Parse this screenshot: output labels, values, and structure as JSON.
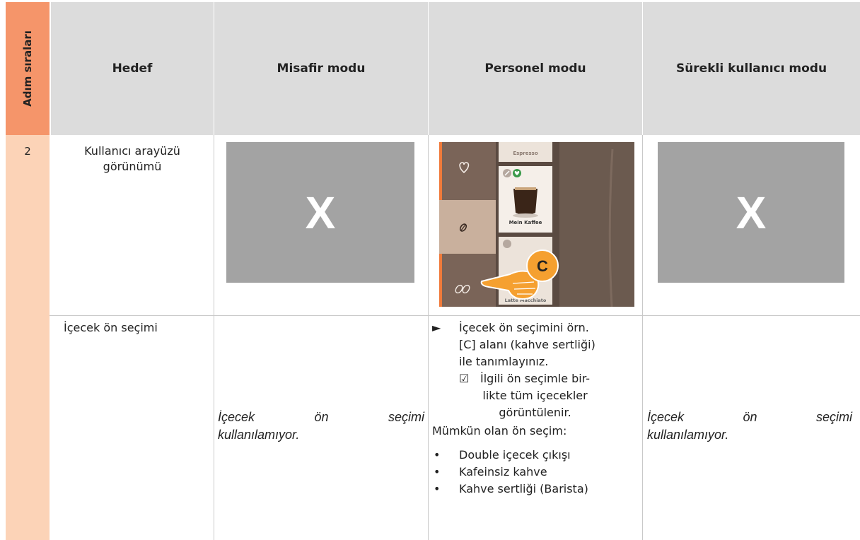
{
  "header": {
    "step_column": "Adım sıraları",
    "target": "Hedef",
    "guest": "Misafir modu",
    "staff": "Personel modu",
    "continuous": "Sürekli kullanıcı modu"
  },
  "rows": [
    {
      "step": "2",
      "target_line1": "Kullanıcı arayüzü",
      "target_line2": "görünümü",
      "guest_mark": "X",
      "continuous_mark": "X",
      "staff_screenshot": {
        "top_label": "Espresso",
        "card_label": "Mein Kaffee",
        "bottom_label": "Latte Macchiato",
        "callout": "C"
      }
    },
    {
      "target": "İçecek ön seçimi",
      "guest_line1_words": [
        "İçecek",
        "ön",
        "seçimi"
      ],
      "guest_line2": "kullanılamıyor.",
      "continuous_line1_words": [
        "İçecek",
        "ön",
        "seçimi"
      ],
      "continuous_line2": "kullanılamıyor.",
      "staff": {
        "step_marker": "►",
        "step_lines": [
          "İçecek ön seçimini örn.",
          "[C] alanı (kahve sertliği)",
          "ile tanımlayınız."
        ],
        "result_marker": "☑",
        "result_lines": [
          "İlgili ön seçimle bir-",
          "likte tüm içecekler",
          "görüntülenir."
        ],
        "possible_label": "Mümkün olan ön seçim:",
        "bullet_marker": "•",
        "options": [
          "Double içecek çıkışı",
          "Kafeinsiz kahve",
          "Kahve sertliği (Barista)"
        ]
      }
    }
  ]
}
